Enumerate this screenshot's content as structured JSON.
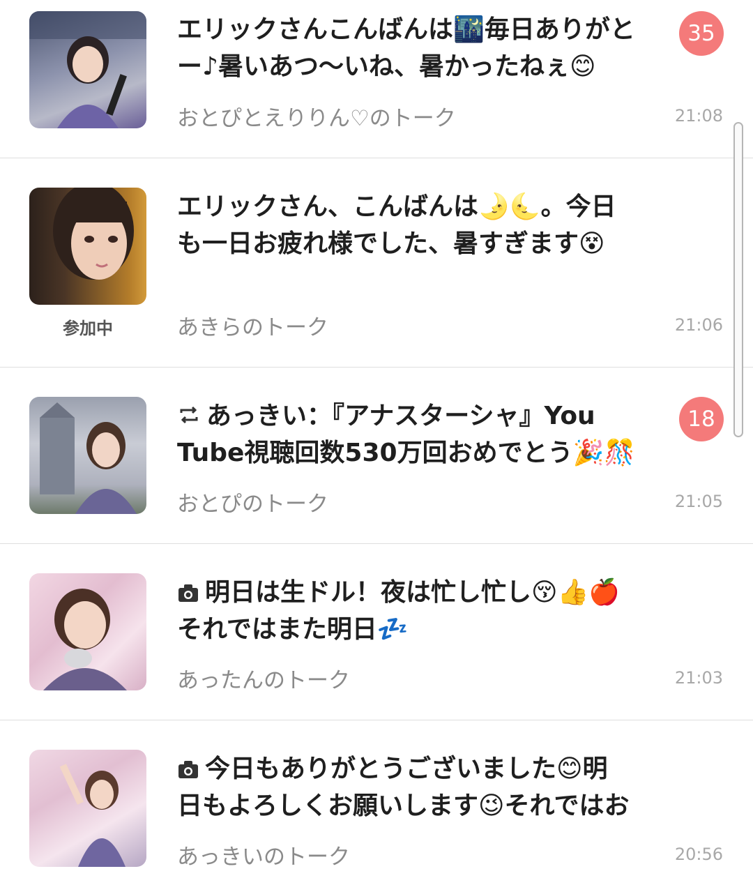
{
  "chats": [
    {
      "line1": "エリックさんこんばんは🌃毎日ありがと",
      "line2": "ー♪暑いあつ〜いね、暑かったねぇ😊",
      "prefix_icon": "",
      "room": "おとぴとえりりん♡のトーク",
      "time": "21:08",
      "badge": "35",
      "joining": "",
      "avatar_colors": [
        "#5a6280",
        "#9aa0b8",
        "#7469a8"
      ]
    },
    {
      "line1": "エリックさん、こんばんは🌛🌜。今日",
      "line2": "も一日お疲れ様でした、暑すぎます😵",
      "prefix_icon": "",
      "room": "あきらのトーク",
      "time": "21:06",
      "badge": "",
      "joining": "参加中",
      "avatar_colors": [
        "#3a2b22",
        "#e9c7b1",
        "#b07a1c"
      ]
    },
    {
      "line1": "あっきい：『アナスターシャ』You",
      "line2": "Tube視聴回数530万回おめでとう🎉🎊",
      "prefix_icon": "repost-icon",
      "room": "おとぴのトーク",
      "time": "21:05",
      "badge": "18",
      "joining": "",
      "avatar_colors": [
        "#8c93a4",
        "#c5c9d3",
        "#6a6790"
      ]
    },
    {
      "line1": "明日は生ドル！夜は忙し忙し😚👍🍎",
      "line2": "それではまた明日💤",
      "prefix_icon": "camera-icon",
      "room": "あったんのトーク",
      "time": "21:03",
      "badge": "",
      "joining": "",
      "avatar_colors": [
        "#e8c6d6",
        "#f3dbe6",
        "#6b5f8a"
      ]
    },
    {
      "line1": "今日もありがとうございました😊明",
      "line2": "日もよろしくお願いします😉それではお",
      "prefix_icon": "camera-icon",
      "room": "あっきいのトーク",
      "time": "20:56",
      "badge": "",
      "joining": "",
      "avatar_colors": [
        "#e5c8d8",
        "#f2dde8",
        "#7468a0"
      ]
    }
  ]
}
